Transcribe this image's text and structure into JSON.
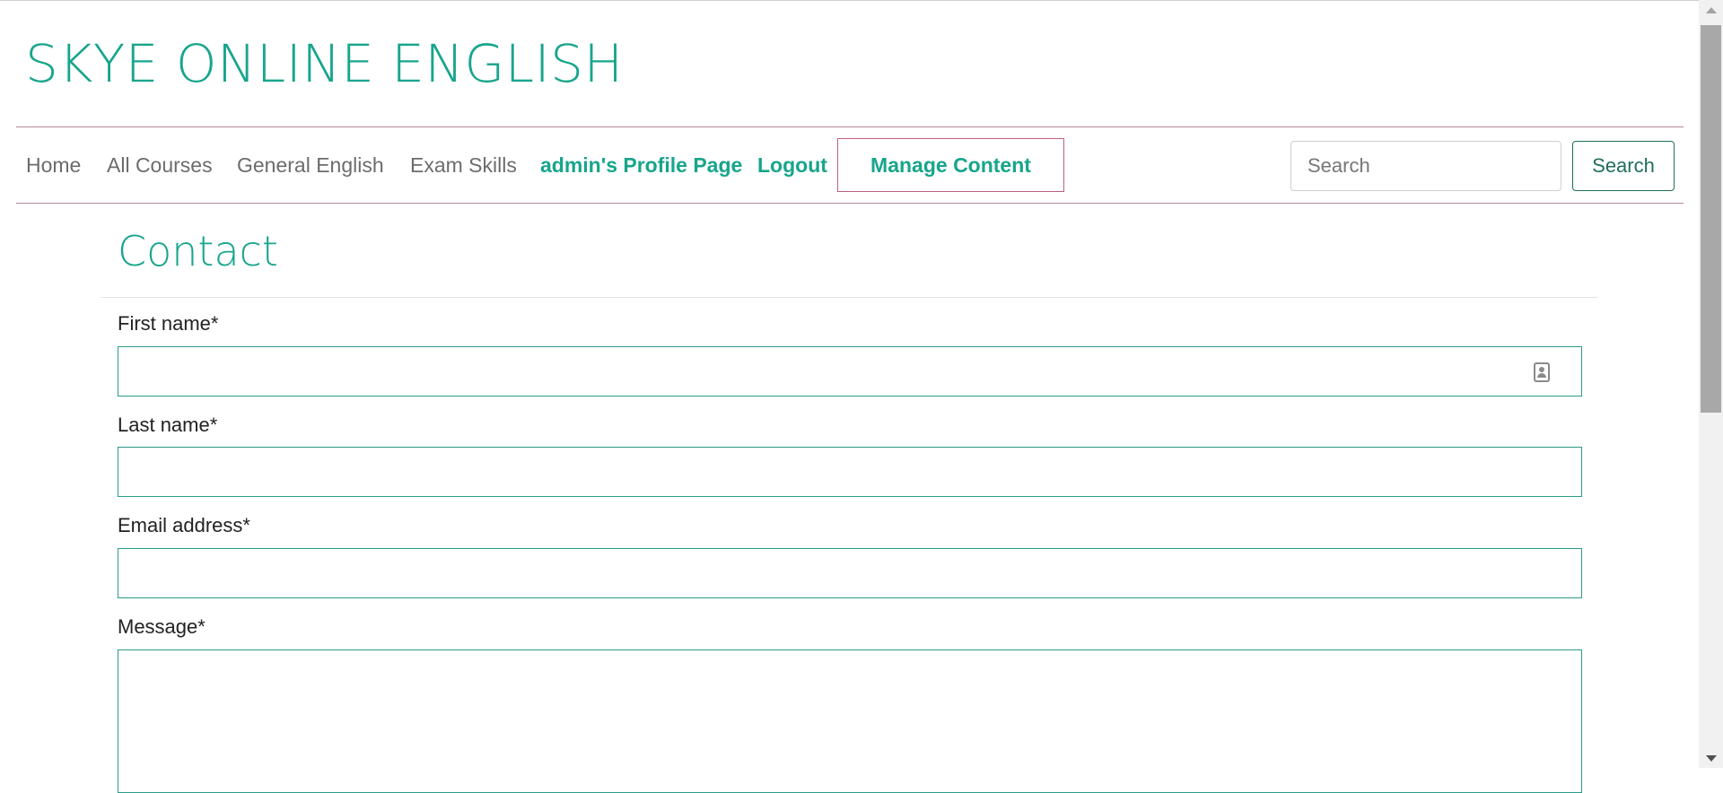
{
  "site": {
    "title": "SKYE ONLINE ENGLISH"
  },
  "nav": {
    "items": [
      {
        "label": "Home",
        "active": false
      },
      {
        "label": "All Courses",
        "active": false
      },
      {
        "label": "General English",
        "active": false
      },
      {
        "label": "Exam Skills",
        "active": false
      },
      {
        "label": "admin's Profile Page",
        "active": true
      },
      {
        "label": "Logout",
        "active": true
      }
    ],
    "manage_label": "Manage Content",
    "search_placeholder": "Search",
    "search_button": "Search"
  },
  "page": {
    "heading": "Contact"
  },
  "form": {
    "first_name_label": "First name*",
    "last_name_label": "Last name*",
    "email_label": "Email address*",
    "message_label": "Message*",
    "first_name_value": "",
    "last_name_value": "",
    "email_value": "",
    "message_value": ""
  },
  "colors": {
    "accent": "#17a58c",
    "nav_border": "#b48a92",
    "manage_border": "#c0607a",
    "search_button": "#1f6f5a",
    "input_border": "#2a9c88"
  },
  "icons": {
    "contact_card": "contact-card-icon"
  }
}
